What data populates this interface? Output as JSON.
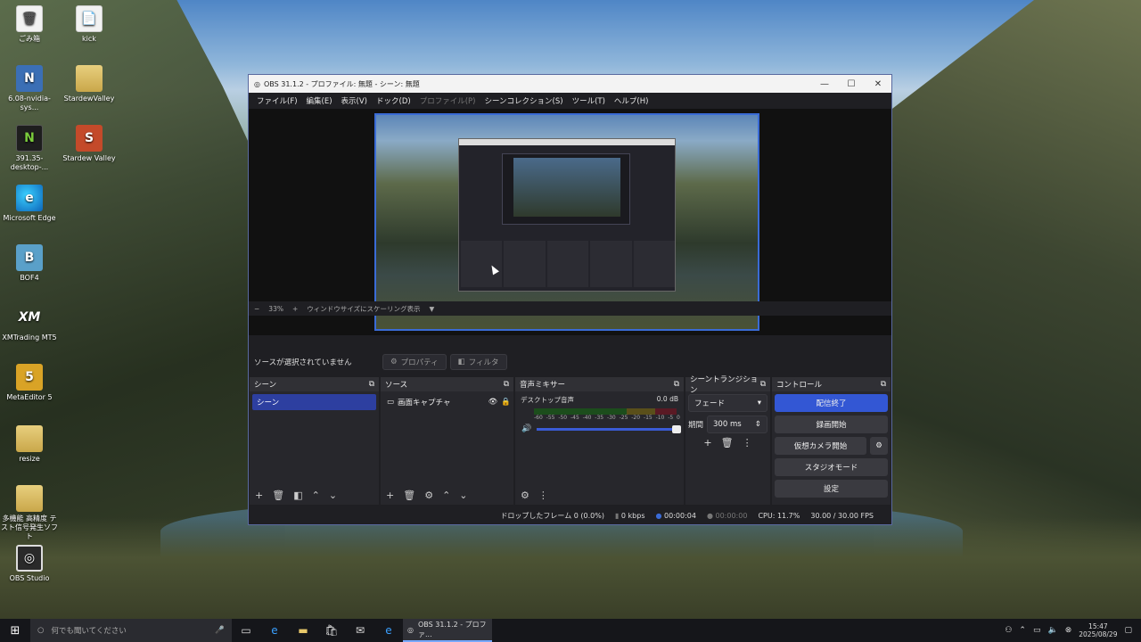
{
  "desktop": {
    "icons": [
      {
        "label": "ごみ箱",
        "glyph": "🗑"
      },
      {
        "label": "kick",
        "glyph": "📄"
      },
      {
        "label": "6.08-nvidia-sys...",
        "glyph": "N"
      },
      {
        "label": "StardewValley",
        "glyph": ""
      },
      {
        "label": "391.35-desktop-...",
        "glyph": "N"
      },
      {
        "label": "Stardew Valley",
        "glyph": "S"
      },
      {
        "label": "Microsoft Edge",
        "glyph": "e"
      },
      {
        "label": "BOF4",
        "glyph": "B"
      },
      {
        "label": "XMTrading MT5",
        "glyph": "XM"
      },
      {
        "label": "MetaEditor 5",
        "glyph": "5"
      },
      {
        "label": "resize",
        "glyph": ""
      },
      {
        "label": "多機能 高精度 テスト信号発生ソフト",
        "glyph": ""
      },
      {
        "label": "OBS Studio",
        "glyph": "◎"
      }
    ]
  },
  "obs": {
    "title": "OBS 31.1.2 - プロファイル: 無題 - シーン: 無題",
    "menu": [
      "ファイル(F)",
      "編集(E)",
      "表示(V)",
      "ドック(D)",
      "プロファイル(P)",
      "シーンコレクション(S)",
      "ツール(T)",
      "ヘルプ(H)"
    ],
    "preview_footer": {
      "minus": "−",
      "zoom": "33%",
      "plus": "+",
      "scaling": "ウィンドウサイズにスケーリング表示"
    },
    "source_bar": {
      "none_selected": "ソースが選択されていません",
      "properties": "プロパティ",
      "filters": "フィルタ"
    },
    "docks": {
      "scenes": {
        "title": "シーン",
        "items": [
          "シーン"
        ]
      },
      "sources": {
        "title": "ソース",
        "items": [
          "画面キャプチャ"
        ]
      },
      "mixer": {
        "title": "音声ミキサー",
        "channel": "デスクトップ音声",
        "level": "0.0 dB",
        "scale": [
          "-60",
          "-55",
          "-50",
          "-45",
          "-40",
          "-35",
          "-30",
          "-25",
          "-20",
          "-15",
          "-10",
          "-5",
          "0"
        ],
        "volume_fraction": 1.0
      },
      "transitions": {
        "title": "シーントランジション",
        "type": "フェード",
        "duration_label": "期間",
        "duration": "300 ms"
      },
      "controls": {
        "title": "コントロール",
        "buttons": [
          "配信終了",
          "録画開始",
          "仮想カメラ開始",
          "スタジオモード",
          "設定"
        ]
      }
    },
    "status": {
      "dropped": "ドロップしたフレーム 0 (0.0%)",
      "bitrate": "0 kbps",
      "stream_time": "00:00:04",
      "rec_time": "00:00:00",
      "cpu": "CPU: 11.7%",
      "fps": "30.00 / 30.00 FPS"
    }
  },
  "taskbar": {
    "search_placeholder": "何でも聞いてください",
    "app_label": "OBS 31.1.2 - プロファ...",
    "time": "15:47",
    "date": "2025/08/29"
  }
}
